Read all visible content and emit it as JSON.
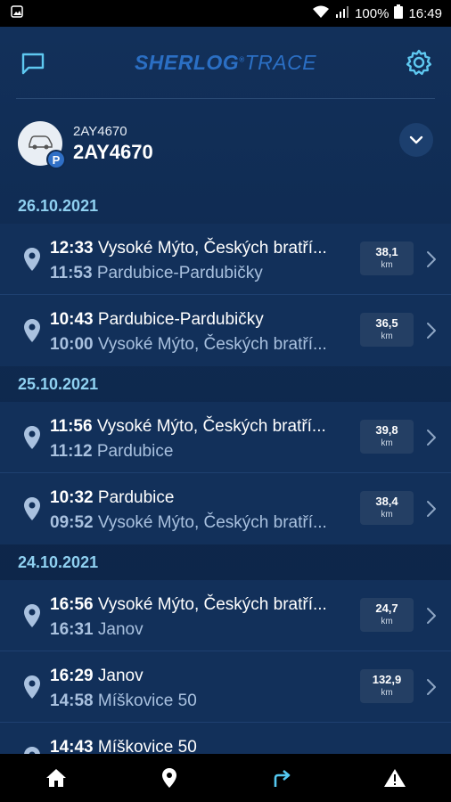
{
  "status_bar": {
    "left_icon": "image-icon",
    "battery": "100%",
    "time": "16:49"
  },
  "header": {
    "logo_main": "SHERLOG",
    "logo_sub": "TRACE",
    "left_icon": "chat-icon",
    "right_icon": "gear-icon"
  },
  "vehicle": {
    "subtitle": "2AY4670",
    "title": "2AY4670",
    "badge": "P"
  },
  "groups": [
    {
      "date": "26.10.2021",
      "trips": [
        {
          "arr_time": "12:33",
          "arr_place": "Vysoké Mýto, Českých bratří...",
          "dep_time": "11:53",
          "dep_place": "Pardubice-Pardubičky",
          "distance": "38,1",
          "unit": "km"
        },
        {
          "arr_time": "10:43",
          "arr_place": "Pardubice-Pardubičky",
          "dep_time": "10:00",
          "dep_place": "Vysoké Mýto, Českých bratří...",
          "distance": "36,5",
          "unit": "km"
        }
      ]
    },
    {
      "date": "25.10.2021",
      "trips": [
        {
          "arr_time": "11:56",
          "arr_place": "Vysoké Mýto, Českých bratří...",
          "dep_time": "11:12",
          "dep_place": "Pardubice",
          "distance": "39,8",
          "unit": "km"
        },
        {
          "arr_time": "10:32",
          "arr_place": "Pardubice",
          "dep_time": "09:52",
          "dep_place": "Vysoké Mýto, Českých bratří...",
          "distance": "38,4",
          "unit": "km"
        }
      ]
    },
    {
      "date": "24.10.2021",
      "trips": [
        {
          "arr_time": "16:56",
          "arr_place": "Vysoké Mýto, Českých bratří...",
          "dep_time": "16:31",
          "dep_place": "Janov",
          "distance": "24,7",
          "unit": "km"
        },
        {
          "arr_time": "16:29",
          "arr_place": "Janov",
          "dep_time": "14:58",
          "dep_place": "Míškovice 50",
          "distance": "132,9",
          "unit": "km"
        },
        {
          "arr_time": "14:43",
          "arr_place": "Míškovice 50",
          "dep_time": "",
          "dep_place": "",
          "distance": "",
          "unit": ""
        }
      ]
    }
  ],
  "bottom_nav": [
    {
      "icon": "home-icon",
      "active": false
    },
    {
      "icon": "location-pin-icon",
      "active": false
    },
    {
      "icon": "trips-arrow-icon",
      "active": true
    },
    {
      "icon": "warning-icon",
      "active": false
    }
  ],
  "colors": {
    "background": "#0f2a50",
    "row": "#12305a",
    "accent": "#8fd0f0",
    "logo": "#2b6fc4",
    "active_nav": "#55c8f0"
  }
}
